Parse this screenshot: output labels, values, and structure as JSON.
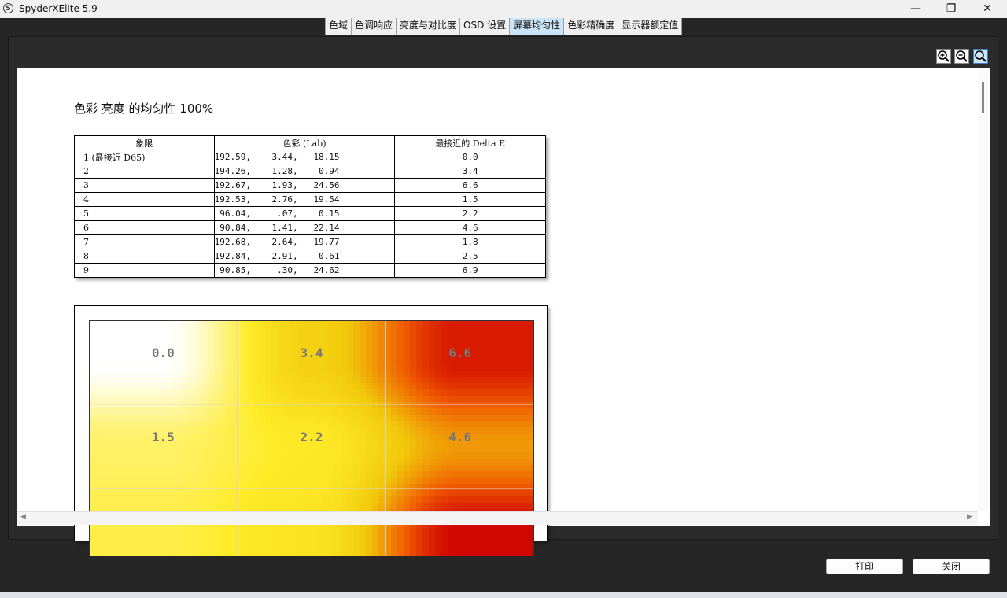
{
  "window": {
    "title": "SpyderXElite 5.9",
    "app_icon": "S"
  },
  "tabs": [
    {
      "label": "色域",
      "active": false
    },
    {
      "label": "色调响应",
      "active": false
    },
    {
      "label": "亮度与对比度",
      "active": false
    },
    {
      "label": "OSD 设置",
      "active": false
    },
    {
      "label": "屏幕均匀性",
      "active": true
    },
    {
      "label": "色彩精确度",
      "active": false
    },
    {
      "label": "显示器额定值",
      "active": false
    }
  ],
  "zoom_icons": [
    "zoom-in-icon",
    "zoom-out-icon",
    "zoom-fit-icon"
  ],
  "report": {
    "title": "色彩 亮度 的均匀性 100%",
    "table": {
      "headers": [
        "象限",
        "色彩 (Lab)",
        "最接近的 Delta E"
      ],
      "rows": [
        {
          "quadrant": "1 (最接近 D65)",
          "lab": "192.59,    3.44,   18.15",
          "delta": "0.0"
        },
        {
          "quadrant": "2",
          "lab": "194.26,    1.28,    0.94",
          "delta": "3.4"
        },
        {
          "quadrant": "3",
          "lab": "192.67,    1.93,   24.56",
          "delta": "6.6"
        },
        {
          "quadrant": "4",
          "lab": "192.53,    2.76,   19.54",
          "delta": "1.5"
        },
        {
          "quadrant": "5",
          "lab": " 96.04,     .07,    0.15",
          "delta": "2.2"
        },
        {
          "quadrant": "6",
          "lab": " 90.84,    1.41,   22.14",
          "delta": "4.6"
        },
        {
          "quadrant": "7",
          "lab": "192.68,    2.64,   19.77",
          "delta": "1.8"
        },
        {
          "quadrant": "8",
          "lab": "192.84,    2.91,    0.61",
          "delta": "2.5"
        },
        {
          "quadrant": "9",
          "lab": " 90.85,     .30,   24.62",
          "delta": "6.9"
        }
      ]
    }
  },
  "chart_data": {
    "type": "heatmap",
    "grid": [
      [
        0.0,
        3.4,
        6.6
      ],
      [
        1.5,
        2.2,
        4.6
      ],
      [
        1.8,
        2.5,
        6.9
      ]
    ],
    "labels": [
      "0.0",
      "3.4",
      "6.6",
      "1.5",
      "2.2",
      "4.6"
    ],
    "colors": {
      "low": "#ffffff",
      "mid": "#f0dc10",
      "high": "#cc0000",
      "contour": "#555555",
      "label": "#777777"
    }
  },
  "buttons": {
    "print": "打印",
    "close": "关闭"
  }
}
